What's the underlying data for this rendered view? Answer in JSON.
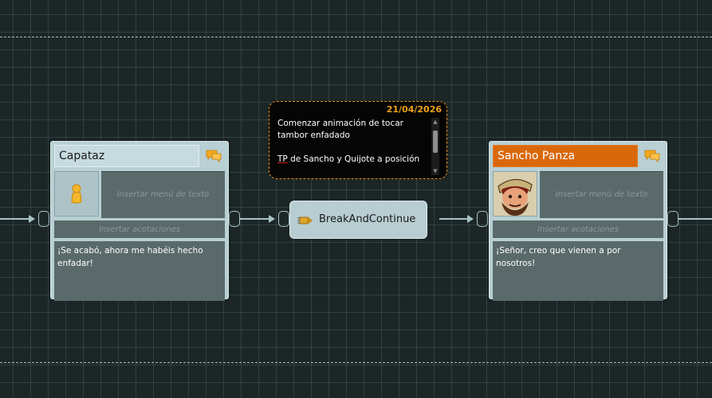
{
  "note": {
    "date": "21/04/2026",
    "line1": "Comenzar animación de tocar",
    "line2": "tambor enfadado",
    "line3_marked": "TP",
    "line3_rest": " de Sancho y Quijote a posición"
  },
  "break_node": {
    "label": "BreakAndContinue",
    "icon": "break-continue-icon"
  },
  "nodes": [
    {
      "title": "Capataz",
      "menu_placeholder": "Insertar menú de texto",
      "acotaciones_placeholder": "Insertar acotaciones",
      "dialog": "¡Se acabó, ahora me habéis hecho enfadar!",
      "portrait_icon": "pawn-icon"
    },
    {
      "title": "Sancho Panza",
      "menu_placeholder": "Insertar menú de texto",
      "acotaciones_placeholder": "Insertar acotaciones",
      "dialog": "¡Señor, creo que vienen a por nosotros!",
      "portrait_icon": "character-portrait",
      "title_color": "#d9680a"
    }
  ],
  "colors": {
    "node_bg": "#b8cfd3",
    "note_border": "#e8901c",
    "date": "#f0a018",
    "connector": "#a9c3c6",
    "canvas": "#1c2627"
  }
}
